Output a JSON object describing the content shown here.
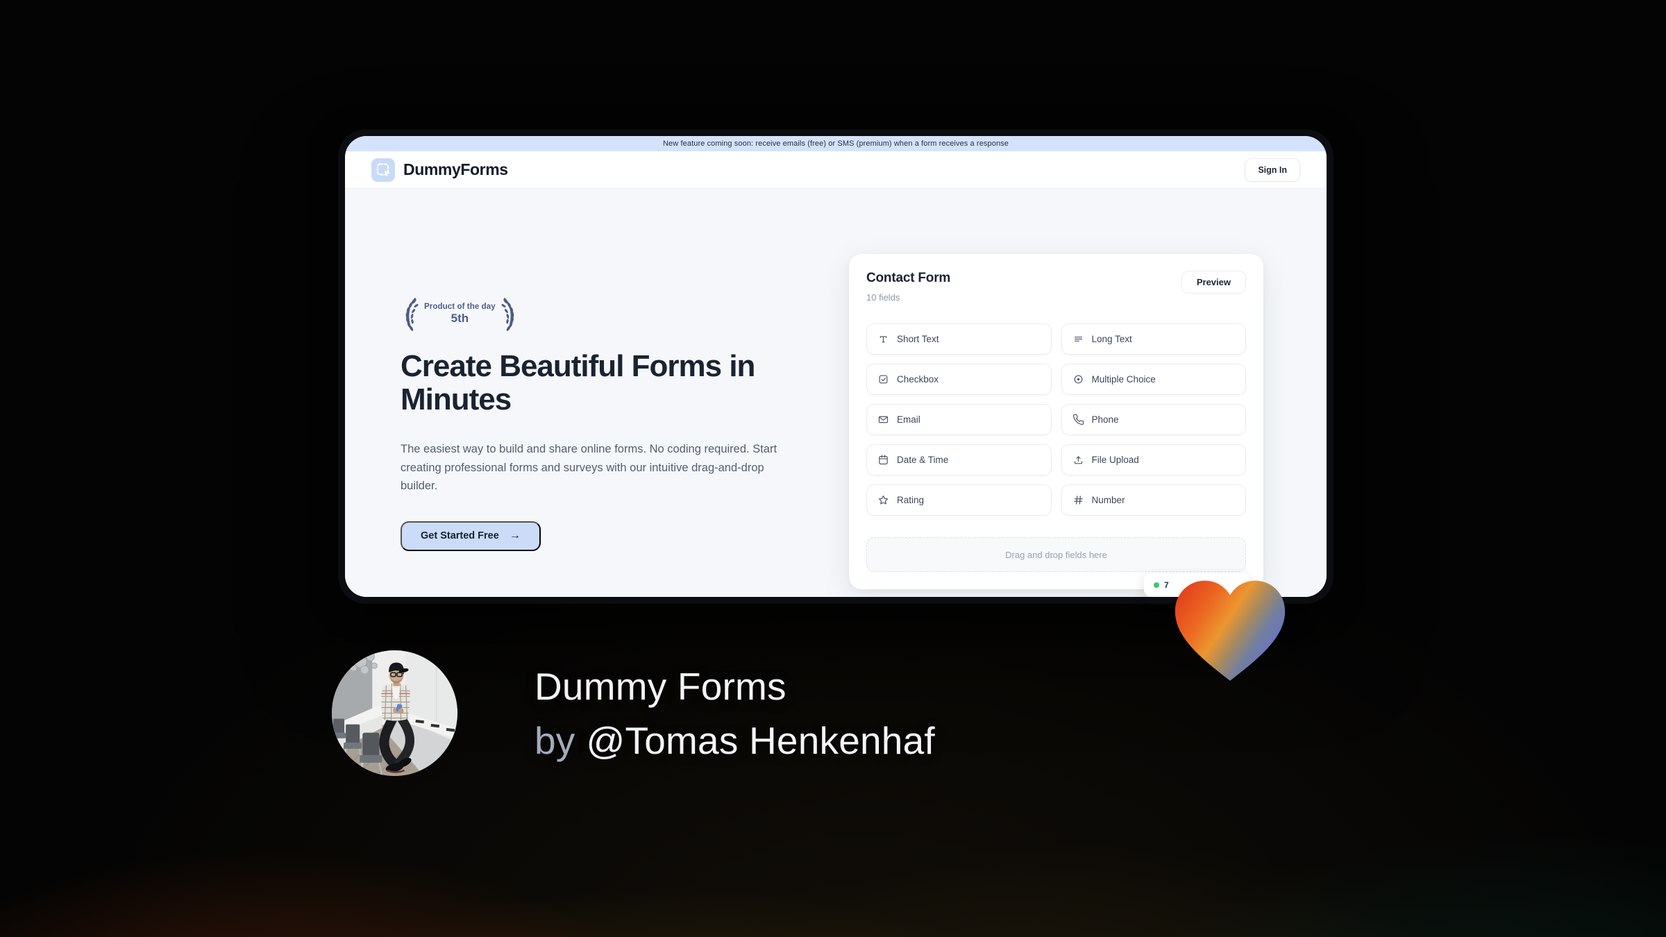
{
  "window": {
    "banner": {
      "text": "New feature coming soon: receive emails (free) or SMS (premium) when a form receives a response"
    },
    "header": {
      "brand": "DummyForms",
      "sign_in_label": "Sign In"
    },
    "hero": {
      "award": {
        "title": "Product of the day",
        "rank": "5th"
      },
      "heading": "Create Beautiful Forms in Minutes",
      "description": "The easiest way to build and share online forms. No coding required. Start creating professional forms and surveys with our intuitive drag-and-drop builder.",
      "cta_label": "Get Started Free",
      "cta_arrow": "→"
    },
    "form_builder": {
      "title": "Contact Form",
      "field_count": "10 fields",
      "preview_label": "Preview",
      "fields": [
        {
          "label": "Short Text",
          "icon": "short-text-icon"
        },
        {
          "label": "Long Text",
          "icon": "long-text-icon"
        },
        {
          "label": "Checkbox",
          "icon": "checkbox-icon"
        },
        {
          "label": "Multiple Choice",
          "icon": "multiple-choice-icon"
        },
        {
          "label": "Email",
          "icon": "email-icon"
        },
        {
          "label": "Phone",
          "icon": "phone-icon"
        },
        {
          "label": "Date & Time",
          "icon": "calendar-icon"
        },
        {
          "label": "File Upload",
          "icon": "upload-icon"
        },
        {
          "label": "Rating",
          "icon": "star-icon"
        },
        {
          "label": "Number",
          "icon": "hash-icon"
        }
      ],
      "dropzone_text": "Drag and drop fields here",
      "status_badge": {
        "text": "7"
      }
    }
  },
  "footer": {
    "product_name": "Dummy Forms",
    "byline_prefix": "by",
    "byline_name": "@Tomas Henkenhaf"
  },
  "colors": {
    "banner_bg": "#d4e3fb",
    "accent_blue": "#c7daf8",
    "award_text": "#4d5d85",
    "status_green": "#3ec56b",
    "heart_gradient": [
      "#e23a1c",
      "#eb9630",
      "#6d6fc9"
    ],
    "background_base": "#040404"
  }
}
